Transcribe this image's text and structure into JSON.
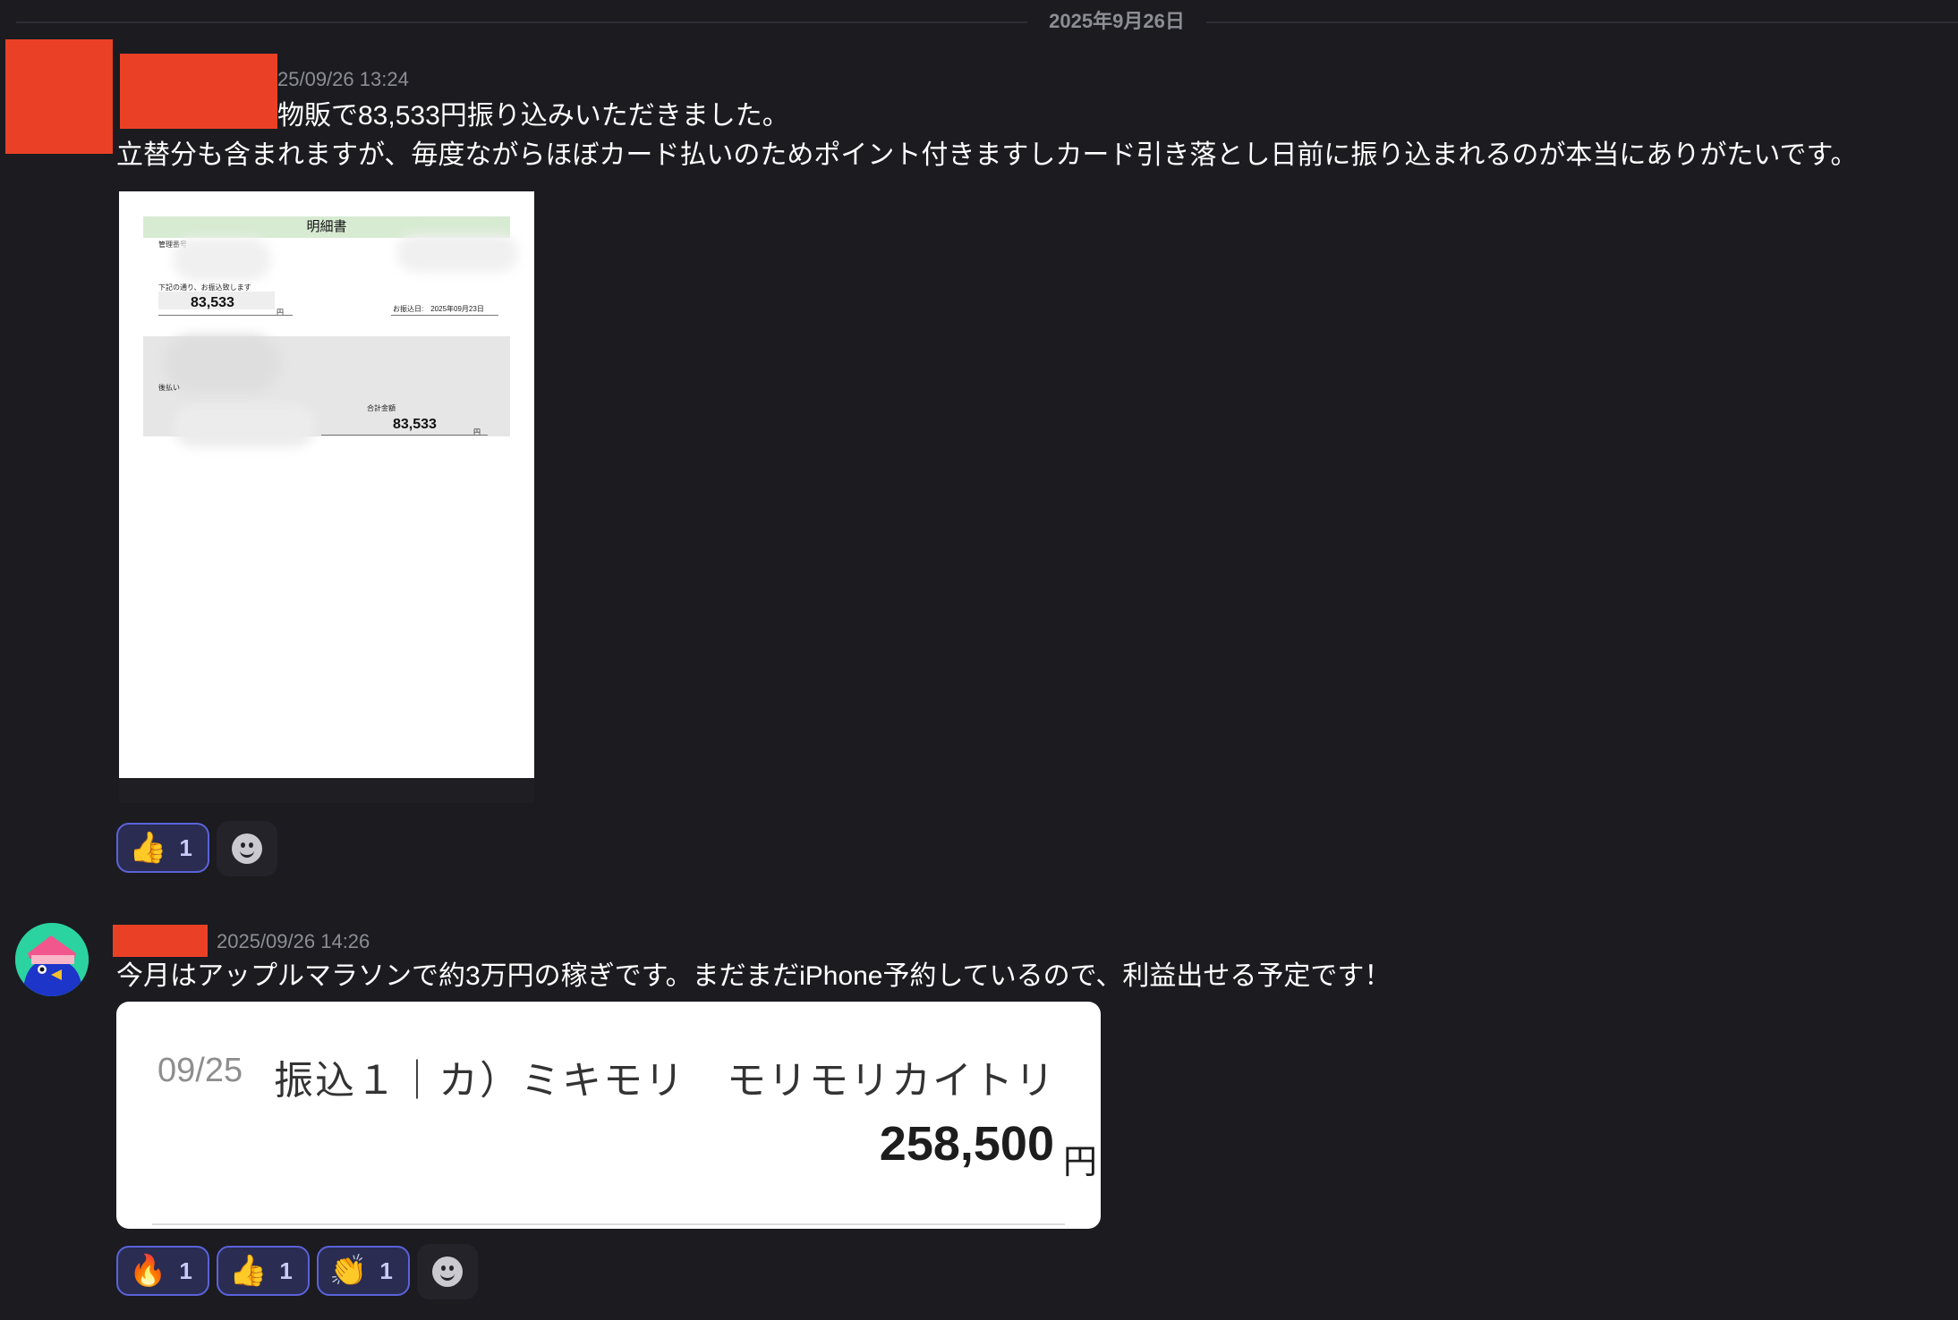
{
  "date_divider": "2025年9月26日",
  "message1": {
    "timestamp": "25/09/26 13:24",
    "line1": "物販で83,533円振り込みいただきました。",
    "line2": "立替分も含まれますが、毎度ながらほぼカード払いのためポイント付きますしカード引き落とし日前に振り込まれるのが本当にありがたいです。",
    "attachment": {
      "header": "明細書",
      "label_manage": "管理番号",
      "label_transfer": "下記の通り、お振込致します",
      "amount": "83,533",
      "unit": "円",
      "transfer_date": "お振込日:　2025年09月23日",
      "label_deferred": "後払い",
      "label_total": "合計金額",
      "total": "83,533",
      "total_unit": "円"
    },
    "reactions": [
      {
        "emoji": "👍",
        "count": "1"
      }
    ]
  },
  "message2": {
    "timestamp": "2025/09/26 14:26",
    "text": "今月はアップルマラソンで約3万円の稼ぎです。まだまだiPhone予約しているので、利益出せる予定です！",
    "bank_card": {
      "date": "09/25",
      "description": "振込１｜カ）ミキモリ　モリモリカイトリ",
      "amount": "258,500",
      "unit": "円"
    },
    "reactions": [
      {
        "emoji": "🔥",
        "count": "1"
      },
      {
        "emoji": "👍",
        "count": "1"
      },
      {
        "emoji": "👏",
        "count": "1"
      }
    ]
  },
  "icons": {
    "add_reaction": "smiley-icon"
  }
}
